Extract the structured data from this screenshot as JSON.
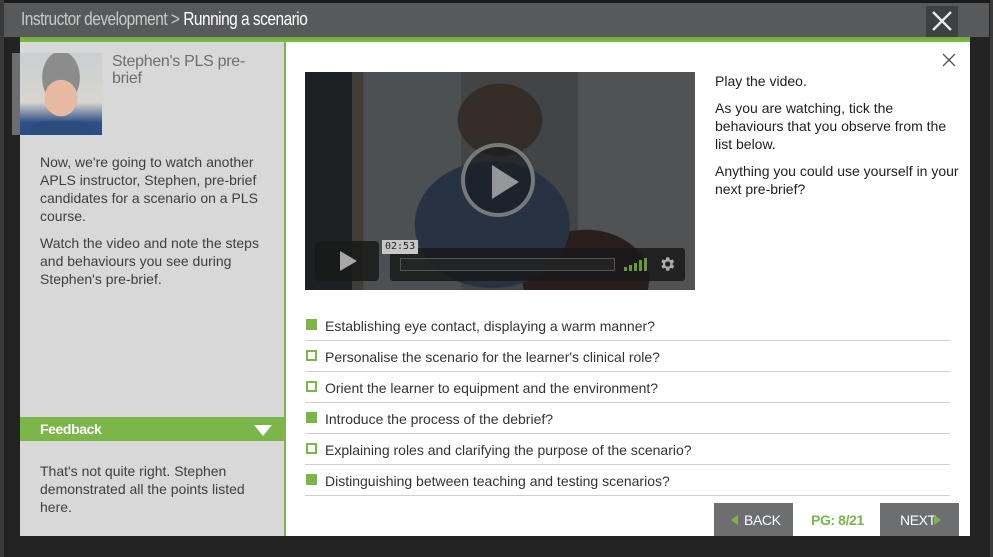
{
  "titlebar": {
    "breadcrumb_parent": "Instructor development",
    "breadcrumb_separator": " > ",
    "breadcrumb_current": "Running a scenario",
    "close_icon": "close-icon"
  },
  "left_panel": {
    "title": "Stephen's PLS pre-brief",
    "avatar_icon": "avatar-photo",
    "paragraphs": [
      "Now, we're going to watch another APLS instructor, Stephen, pre-brief candidates for a scenario on a PLS course.",
      "Watch the video and note the steps and behaviours you see during Stephen's pre-brief."
    ],
    "feedback": {
      "label": "Feedback",
      "toggle_icon": "triangle-down-icon",
      "text": "That's not quite right. Stephen demonstrated all the points listed here."
    }
  },
  "video": {
    "time_tooltip": "02:53",
    "progress_fraction": 0,
    "volume_level_bars": 5,
    "big_play_icon": "play-circle-icon",
    "play_icon": "play-icon",
    "settings_icon": "gear-icon",
    "volume_icon": "volume-bars-icon"
  },
  "instructions": [
    "Play the video.",
    "As you are watching, tick the behaviours that you observe from the list below.",
    "Anything you could use yourself in your next pre-brief?"
  ],
  "checklist": [
    {
      "label": "Establishing eye contact, displaying a warm manner?",
      "checked": true
    },
    {
      "label": "Personalise the scenario for the learner's clinical role?",
      "checked": false
    },
    {
      "label": "Orient the learner to equipment and the environment?",
      "checked": false
    },
    {
      "label": "Introduce the process of the debrief?",
      "checked": true
    },
    {
      "label": "Explaining roles and clarifying the purpose of the scenario?",
      "checked": false
    },
    {
      "label": "Distinguishing between teaching and testing scenarios?",
      "checked": true
    }
  ],
  "navigation": {
    "back_label": "BACK",
    "next_label": "NEXT",
    "page_indicator": "PG: 8/21"
  },
  "colors": {
    "accent_green": "#7ab648",
    "titlebar_bg": "#58595b",
    "frame_bg": "#232323",
    "button_gray": "#6d6e70"
  }
}
